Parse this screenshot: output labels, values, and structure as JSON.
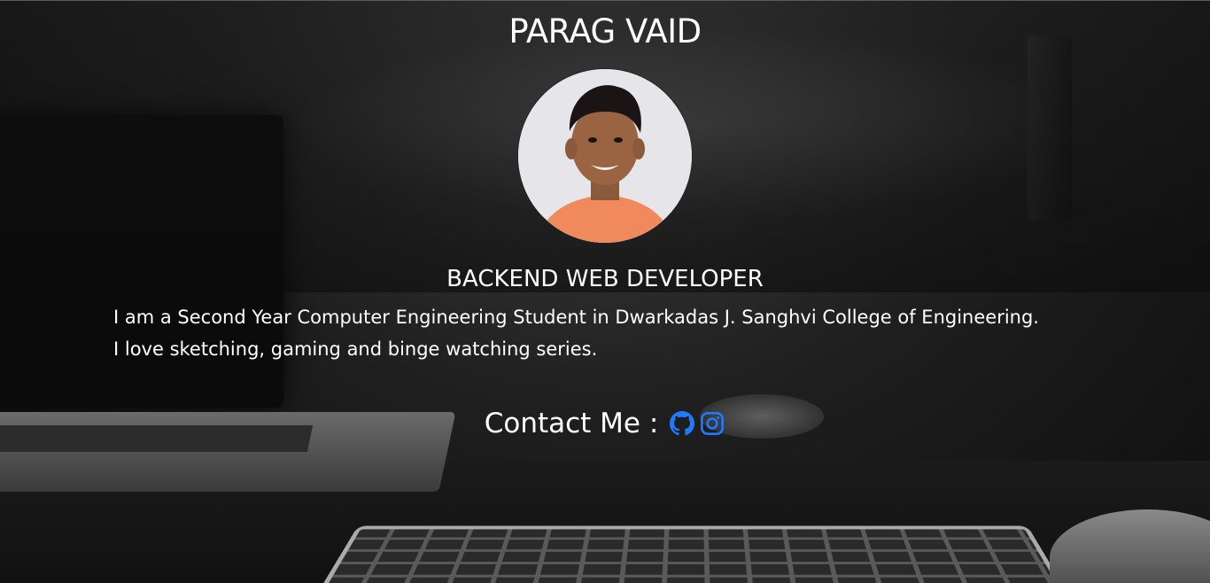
{
  "profile": {
    "name": "PARAG VAID",
    "role": "BACKEND WEB DEVELOPER",
    "bio_line1": "I am a Second Year Computer Engineering Student in Dwarkadas J. Sanghvi College of Engineering.",
    "bio_line2": "I love sketching, gaming and binge watching series."
  },
  "contact": {
    "label": "Contact Me :",
    "links": [
      {
        "icon": "github-icon"
      },
      {
        "icon": "instagram-icon"
      }
    ],
    "icon_color": "#1e7bff"
  },
  "colors": {
    "text": "#ffffff",
    "background": "#141414"
  }
}
